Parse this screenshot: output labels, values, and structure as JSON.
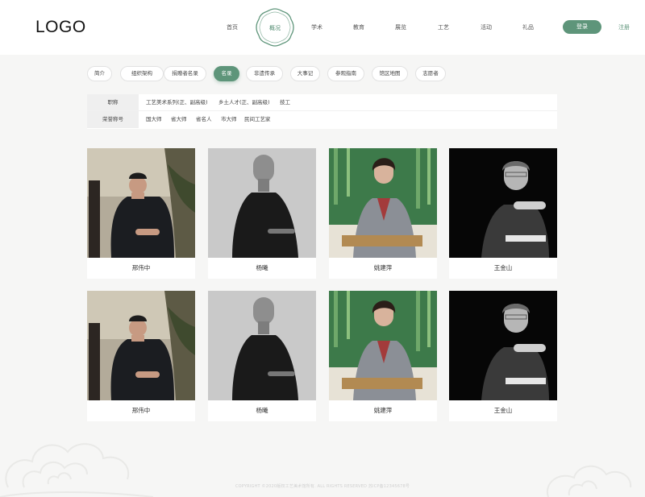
{
  "header": {
    "logo": "LOGO",
    "nav": [
      {
        "label": "首页"
      },
      {
        "label": "概况",
        "active": true
      },
      {
        "label": "学术"
      },
      {
        "label": "教育"
      },
      {
        "label": "展览"
      },
      {
        "label": "工艺"
      },
      {
        "label": "活动"
      },
      {
        "label": "礼品"
      }
    ],
    "login_label": "登录",
    "register_label": "注册"
  },
  "tabs": [
    {
      "label": "简介"
    },
    {
      "label": "组织架构"
    },
    {
      "label": "捐赠者名录"
    },
    {
      "label": "名录",
      "active": true
    },
    {
      "label": "非遗传承"
    },
    {
      "label": "大事记"
    },
    {
      "label": "参观指南"
    },
    {
      "label": "馆区地图"
    },
    {
      "label": "志愿者"
    }
  ],
  "filters": {
    "title_row": {
      "label": "职称",
      "options": [
        "工艺美术系列(正、副高级)",
        "乡土人才(正、副高级)",
        "技工"
      ]
    },
    "honor_row": {
      "label": "荣誉称号",
      "options": [
        "国大师",
        "省大师",
        "省名人",
        "市大师",
        "民间工艺家"
      ]
    }
  },
  "people": [
    {
      "name": "邢伟中"
    },
    {
      "name": "杨曦"
    },
    {
      "name": "姚建萍"
    },
    {
      "name": "王金山"
    },
    {
      "name": "邢伟中"
    },
    {
      "name": "杨曦"
    },
    {
      "name": "姚建萍"
    },
    {
      "name": "王金山"
    }
  ],
  "footer": {
    "text": "COPYRIGHT ©2020版权工艺美术馆所有. ALL RIGHTS RESERVED 苏ICP备12345678号"
  },
  "colors": {
    "accent": "#5e957a",
    "background": "#f6f6f5"
  }
}
